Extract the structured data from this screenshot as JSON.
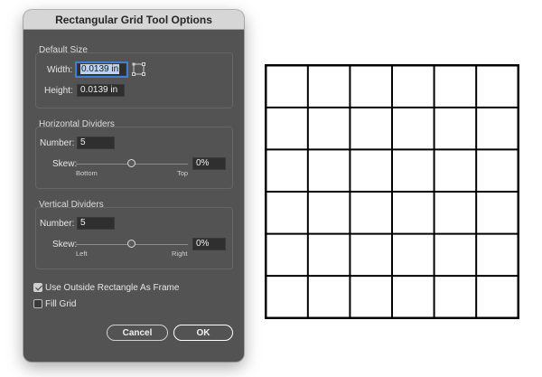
{
  "dialog": {
    "title": "Rectangular Grid Tool Options",
    "default_size": {
      "group_label": "Default Size",
      "width_label": "Width:",
      "width_value": "0.0139 in",
      "height_label": "Height:",
      "height_value": "0.0139 in",
      "reference_point_icon": "reference-point-icon"
    },
    "horizontal_dividers": {
      "group_label": "Horizontal Dividers",
      "number_label": "Number:",
      "number_value": "5",
      "skew_label": "Skew:",
      "skew_value": "0%",
      "skew_position": 0.5,
      "left_hint": "Bottom",
      "right_hint": "Top"
    },
    "vertical_dividers": {
      "group_label": "Vertical Dividers",
      "number_label": "Number:",
      "number_value": "5",
      "skew_label": "Skew:",
      "skew_value": "0%",
      "skew_position": 0.5,
      "left_hint": "Left",
      "right_hint": "Right"
    },
    "use_outside_rect": {
      "label": "Use Outside Rectangle As Frame",
      "checked": true
    },
    "fill_grid": {
      "label": "Fill Grid",
      "checked": false
    },
    "cancel_label": "Cancel",
    "ok_label": "OK"
  },
  "grid_preview": {
    "rows": 6,
    "columns": 6
  },
  "colors": {
    "dialog_bg": "#535353",
    "titlebar_bg": "#d6d6d6",
    "field_bg": "#2f2f2f",
    "focus_ring": "#3e7fd6",
    "grid_line": "#000000"
  }
}
